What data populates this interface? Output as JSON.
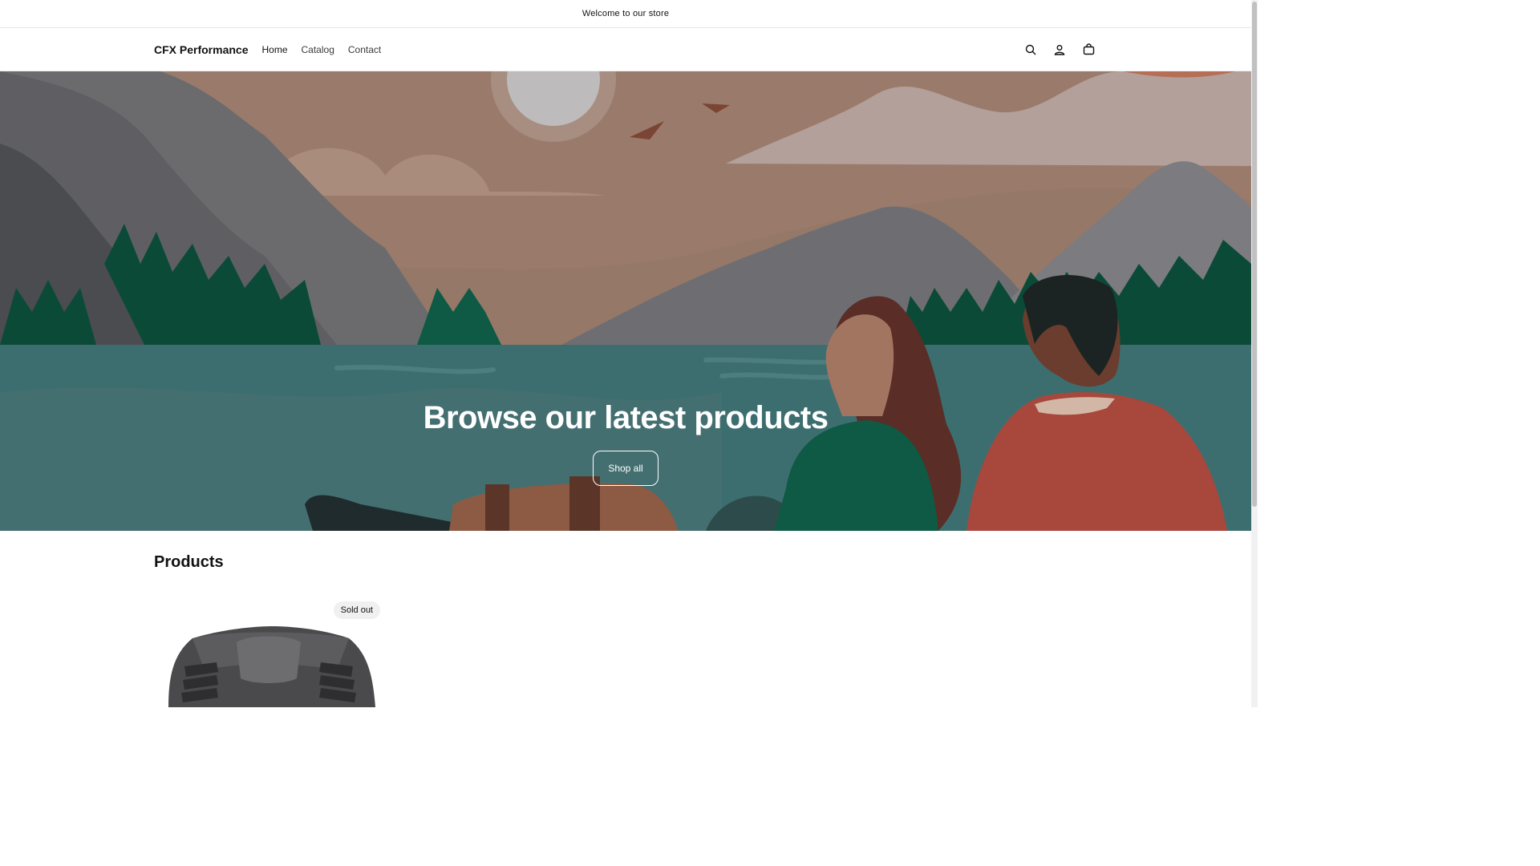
{
  "announcement": {
    "text": "Welcome to our store"
  },
  "header": {
    "logo": "CFX Performance",
    "nav": [
      {
        "label": "Home"
      },
      {
        "label": "Catalog"
      },
      {
        "label": "Contact"
      }
    ],
    "icons": [
      "search-icon",
      "account-icon",
      "cart-icon"
    ]
  },
  "hero": {
    "title": "Browse our latest products",
    "button_label": "Shop all"
  },
  "products": {
    "title": "Products",
    "items": [
      {
        "badge": "Sold out"
      }
    ]
  }
}
